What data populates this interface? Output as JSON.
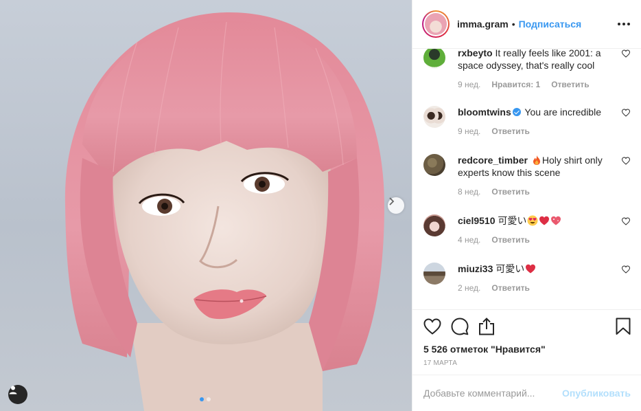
{
  "post_image": {
    "alt": "",
    "carousel_count": 2,
    "carousel_active": 1
  },
  "header": {
    "username": "imma.gram",
    "separator": "•",
    "follow_label": "Подписаться"
  },
  "comments": [
    {
      "username": "rxbeyto",
      "text": "It really feels like 2001: a space odyssey, that's really cool",
      "time": "9 нед.",
      "likes": "Нравится: 1",
      "reply": "Ответить",
      "verified": false
    },
    {
      "username": "bloomtwins",
      "text": "You are incredible",
      "time": "9 нед.",
      "likes": "",
      "reply": "Ответить",
      "verified": true
    },
    {
      "username": "redcore_timber",
      "text": "Holy shirt only experts know this scene",
      "time": "8 нед.",
      "likes": "",
      "reply": "Ответить",
      "verified": false,
      "emoji": [
        "fire"
      ]
    },
    {
      "username": "ciel9510",
      "text": "可愛い",
      "time": "4 нед.",
      "likes": "",
      "reply": "Ответить",
      "verified": false,
      "emoji": [
        "heart-eyes",
        "red-heart",
        "sparkling-heart"
      ]
    },
    {
      "username": "miuzi33",
      "text": "可愛い",
      "time": "2 нед.",
      "likes": "",
      "reply": "Ответить",
      "verified": false,
      "emoji": [
        "red-heart"
      ]
    }
  ],
  "actions": {
    "likes_text": "5 526 отметок \"Нравится\"",
    "date": "17 марта"
  },
  "add_comment": {
    "placeholder": "Добавьте комментарий...",
    "publish_label": "Опубликовать"
  },
  "colors": {
    "accent": "#3897f0",
    "publish_disabled": "#b2dffc",
    "meta_gray": "#999999",
    "hair_pink": "#e9909f"
  }
}
